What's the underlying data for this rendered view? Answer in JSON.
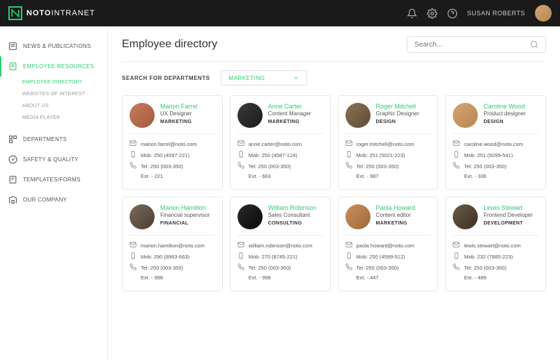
{
  "brand": {
    "bold": "NOTO",
    "light": "INTRANET"
  },
  "topbar": {
    "username": "SUSAN ROBERTS"
  },
  "sidebar": {
    "items": [
      {
        "label": "NEWS & PUBLICATIONS"
      },
      {
        "label": "EMPLOYEE RESOURCES"
      },
      {
        "label": "DEPARTMENTS"
      },
      {
        "label": "SAFETY & QUALITY"
      },
      {
        "label": "TEMPLATES/FORMS"
      },
      {
        "label": "OUR COMPANY"
      }
    ],
    "sub": [
      {
        "label": "EMPLOYEE DIRECTORY"
      },
      {
        "label": "WEBSITES OF INTEREST"
      },
      {
        "label": "ABOUT US"
      },
      {
        "label": "MEDIA PLAYER"
      }
    ]
  },
  "page": {
    "title": "Employee directory",
    "search_placeholder": "Search...",
    "filter_label": "SEARCH FOR DEPARTMENTS",
    "filter_value": "MARKETING"
  },
  "employees": [
    {
      "name": "Marion Farrel",
      "role": "UX Designer",
      "dept": "MARKETING",
      "email": "marion.farrel@noto.com",
      "mob": "Mob: 250 (4597-221)",
      "tel": "Tel: 250 (003-350)",
      "ext": "Ext. - 221"
    },
    {
      "name": "Anne Carter",
      "role": "Content Manager",
      "dept": "MARKETING",
      "email": "anne.carter@noto.com",
      "mob": "Mob: 250 (4587-124)",
      "tel": "Tel: 250 (003-350)",
      "ext": "Ext. - 663"
    },
    {
      "name": "Roger Mitchell",
      "role": "Graphic Designer",
      "dept": "DESIGN",
      "email": "roger.mitchell@noto.com",
      "mob": "Mob: 251 (5021-223)",
      "tel": "Tel: 250 (003-350)",
      "ext": "Ext. - 987"
    },
    {
      "name": "Caroline Wood",
      "role": "Product designer",
      "dept": "DESIGN",
      "email": "caroline.wood@noto.com",
      "mob": "Mob: 251 (5099-541)",
      "tel": "Tel: 250 (003-350)",
      "ext": "Ext. - 336"
    },
    {
      "name": "Marion Hamilton",
      "role": "Financial supervisor",
      "dept": "FINANCIAL",
      "email": "marion.hamilton@noto.com",
      "mob": "Mob: 290 (8963-663)",
      "tel": "Tel: 250 (003-350)",
      "ext": "Ext. - 998"
    },
    {
      "name": "William Robinson",
      "role": "Sales Consultant",
      "dept": "CONSULTING",
      "email": "william.robinson@noto.com",
      "mob": "Mob: 270 (8745-221)",
      "tel": "Tel: 250 (003-350)",
      "ext": "Ext. - 998"
    },
    {
      "name": "Paola Howard",
      "role": "Content editor",
      "dept": "MARKETING",
      "email": "paola.howard@noto.com",
      "mob": "Mob: 250 (4599-512)",
      "tel": "Tel: 250 (003-350)",
      "ext": "Ext. - 447"
    },
    {
      "name": "Lewis Stewart",
      "role": "Frontend Developer",
      "dept": "DEVELOPMENT",
      "email": "lewis.stewart@noto.com",
      "mob": "Mob: 232 (7885-223)",
      "tel": "Tel: 250 (003-350)",
      "ext": "Ext. - 489"
    }
  ]
}
